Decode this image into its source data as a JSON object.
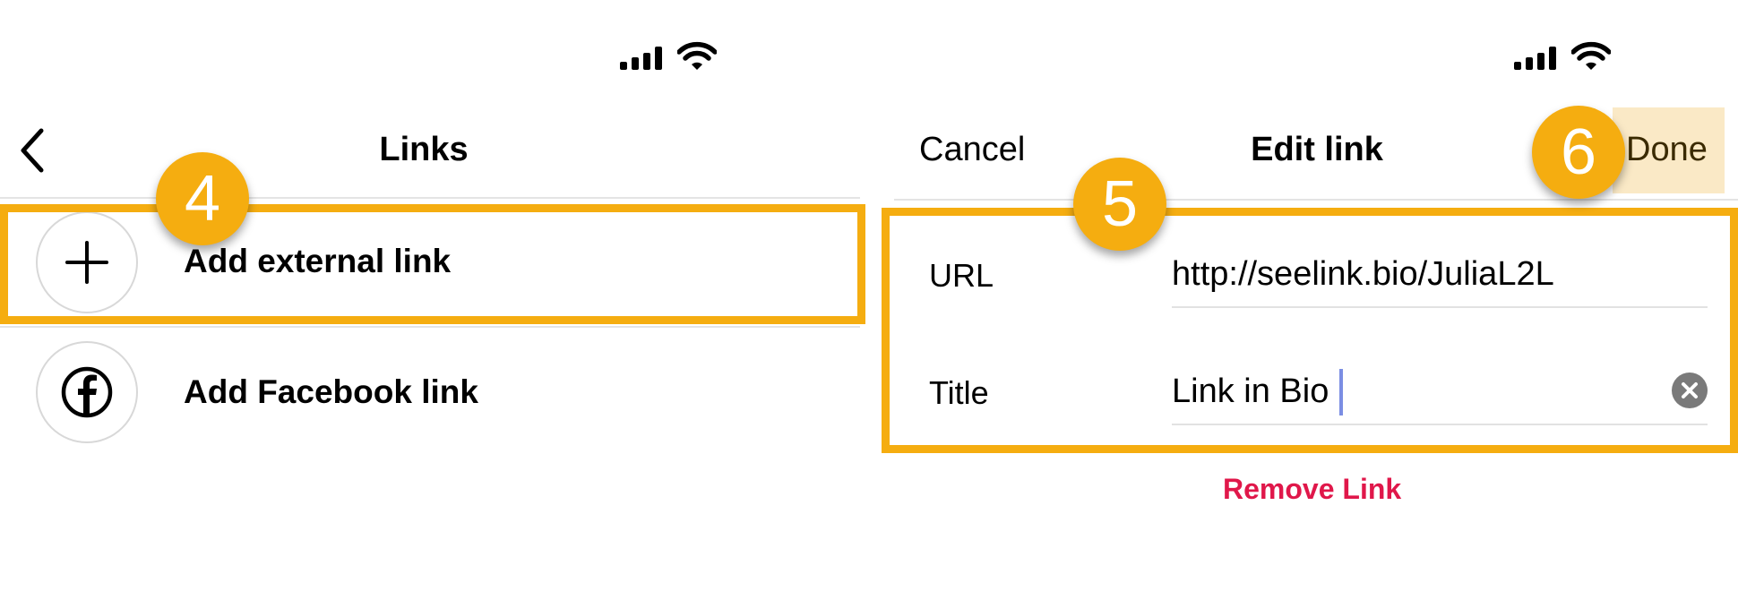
{
  "left_screen": {
    "header": {
      "title": "Links",
      "back_icon": "chevron-left-icon"
    },
    "items": [
      {
        "label": "Add external link",
        "icon": "plus-icon"
      },
      {
        "label": "Add Facebook link",
        "icon": "facebook-icon"
      }
    ]
  },
  "right_screen": {
    "header": {
      "cancel_label": "Cancel",
      "title": "Edit link",
      "done_label": "Done"
    },
    "form": {
      "url_label": "URL",
      "url_value": "http://seelink.bio/JuliaL2L",
      "title_label": "Title",
      "title_value": "Link in Bio",
      "clear_icon": "clear-circle-icon"
    },
    "remove_label": "Remove Link"
  },
  "annotations": {
    "step_4": "4",
    "step_5": "5",
    "step_6": "6",
    "highlight_color": "#f5ad10"
  },
  "colors": {
    "remove_link": "#e0174a",
    "done_highlight": "#fae9c6",
    "caret": "#7b8ee3"
  }
}
